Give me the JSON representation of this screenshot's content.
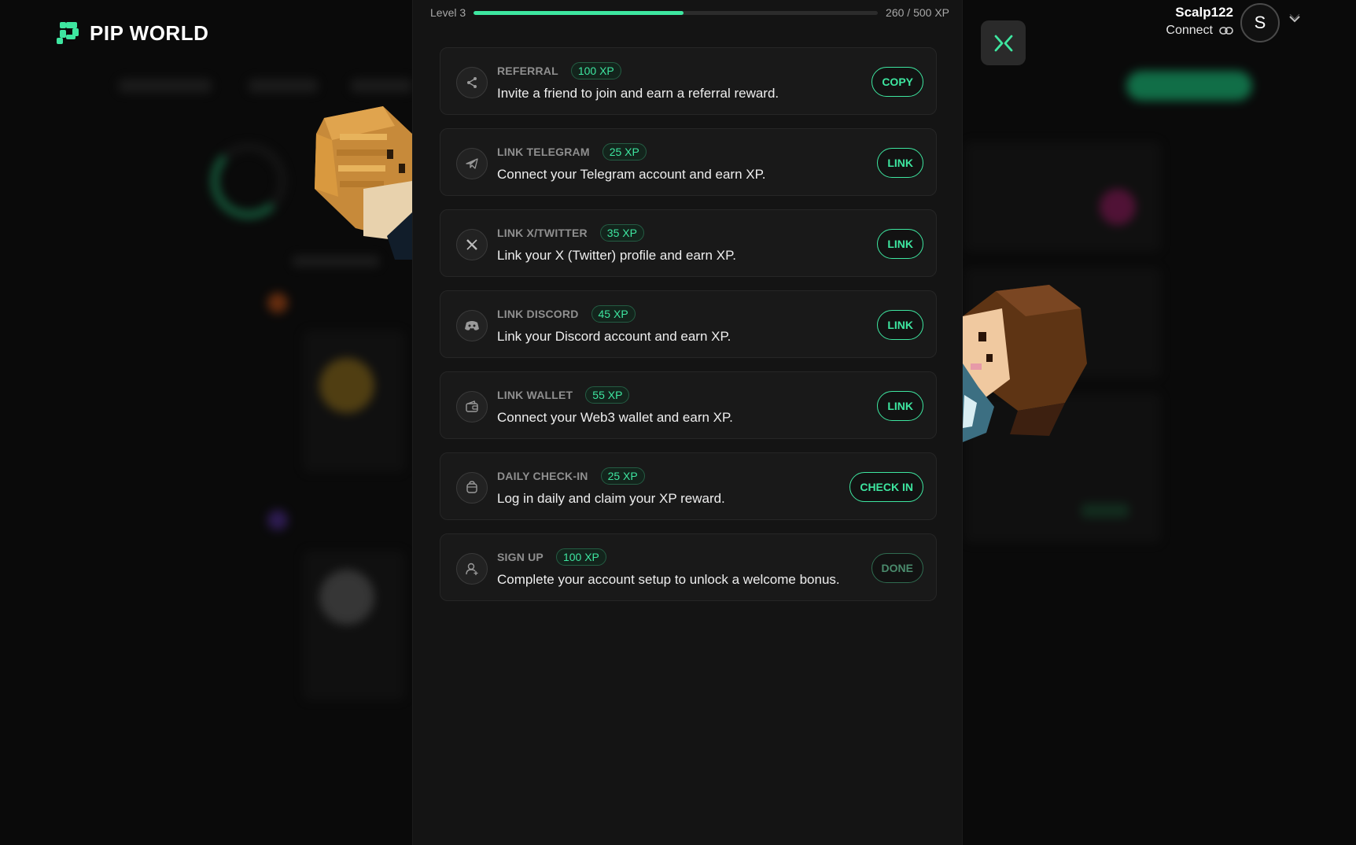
{
  "brand": {
    "name": "PIP WORLD",
    "accent": "#3ee6a0"
  },
  "user": {
    "name": "Scalp122",
    "connect_label": "Connect",
    "avatar_letter": "S"
  },
  "level": {
    "label": "Level 3",
    "xp_text": "260 / 500 XP",
    "progress": 0.52
  },
  "tasks": [
    {
      "title": "REFERRAL",
      "xp": "100 XP",
      "desc": "Invite a friend to join and earn a referral reward.",
      "button": "COPY",
      "icon": "share-icon",
      "state": "active"
    },
    {
      "title": "LINK TELEGRAM",
      "xp": "25 XP",
      "desc": "Connect your Telegram account and earn XP.",
      "button": "LINK",
      "icon": "telegram-icon",
      "state": "active"
    },
    {
      "title": "LINK X/TWITTER",
      "xp": "35 XP",
      "desc": "Link your X (Twitter) profile and earn XP.",
      "button": "LINK",
      "icon": "x-icon",
      "state": "active"
    },
    {
      "title": "LINK DISCORD",
      "xp": "45 XP",
      "desc": "Link your Discord account and earn XP.",
      "button": "LINK",
      "icon": "discord-icon",
      "state": "active"
    },
    {
      "title": "LINK WALLET",
      "xp": "55 XP",
      "desc": "Connect your Web3 wallet and earn XP.",
      "button": "LINK",
      "icon": "wallet-icon",
      "state": "active"
    },
    {
      "title": "DAILY CHECK-IN",
      "xp": "25 XP",
      "desc": "Log in daily and claim your XP reward.",
      "button": "CHECK IN",
      "icon": "calendar-icon",
      "state": "active"
    },
    {
      "title": "SIGN UP",
      "xp": "100 XP",
      "desc": "Complete your account setup to unlock a welcome bonus.",
      "button": "DONE",
      "icon": "user-add-icon",
      "state": "done"
    }
  ]
}
